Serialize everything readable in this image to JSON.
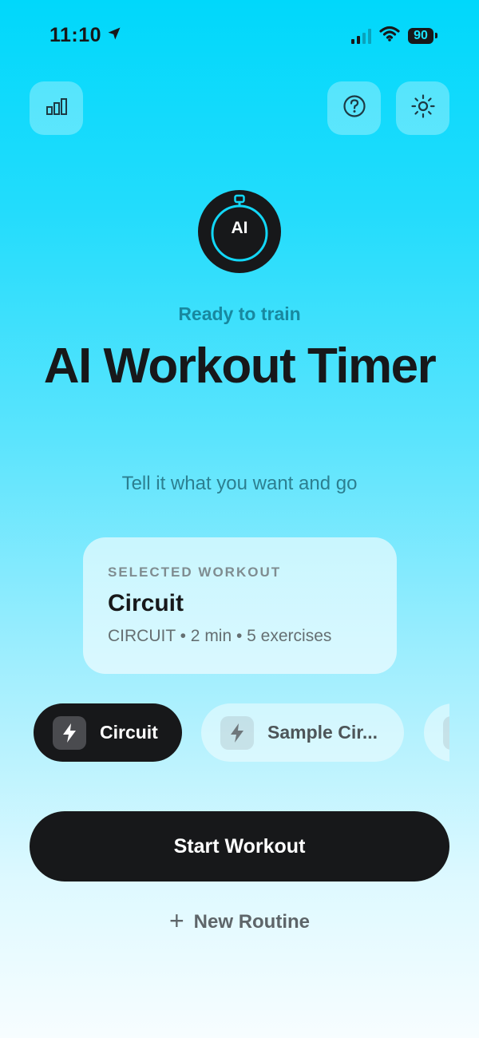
{
  "status_bar": {
    "time": "11:10",
    "battery_percent": "90",
    "location_icon": "location-arrow-icon",
    "signal_icon": "cellular-signal-icon",
    "wifi_icon": "wifi-icon"
  },
  "top_buttons": {
    "stats_icon": "bar-chart-icon",
    "help_icon": "question-circle-icon",
    "theme_icon": "sun-icon"
  },
  "logo": {
    "text": "AI",
    "icon": "stopwatch-icon"
  },
  "hero": {
    "eyebrow": "Ready to train",
    "title": "AI Workout Timer",
    "subtitle": "Tell it what you want and go"
  },
  "selected_workout": {
    "label": "SELECTED WORKOUT",
    "name": "Circuit",
    "meta": "CIRCUIT • 2 min • 5 exercises"
  },
  "workout_chips": [
    {
      "label": "Circuit",
      "icon": "lightning-bolt-icon",
      "selected": true
    },
    {
      "label": "Sample Cir...",
      "icon": "lightning-bolt-icon",
      "selected": false
    },
    {
      "label": "",
      "icon": "lightning-bolt-icon",
      "selected": false
    }
  ],
  "actions": {
    "start_label": "Start Workout",
    "new_routine_label": "New Routine",
    "new_routine_icon": "plus-icon"
  },
  "colors": {
    "accent": "#00d8fb",
    "eyebrow": "#18889f",
    "ink": "#17181a"
  }
}
